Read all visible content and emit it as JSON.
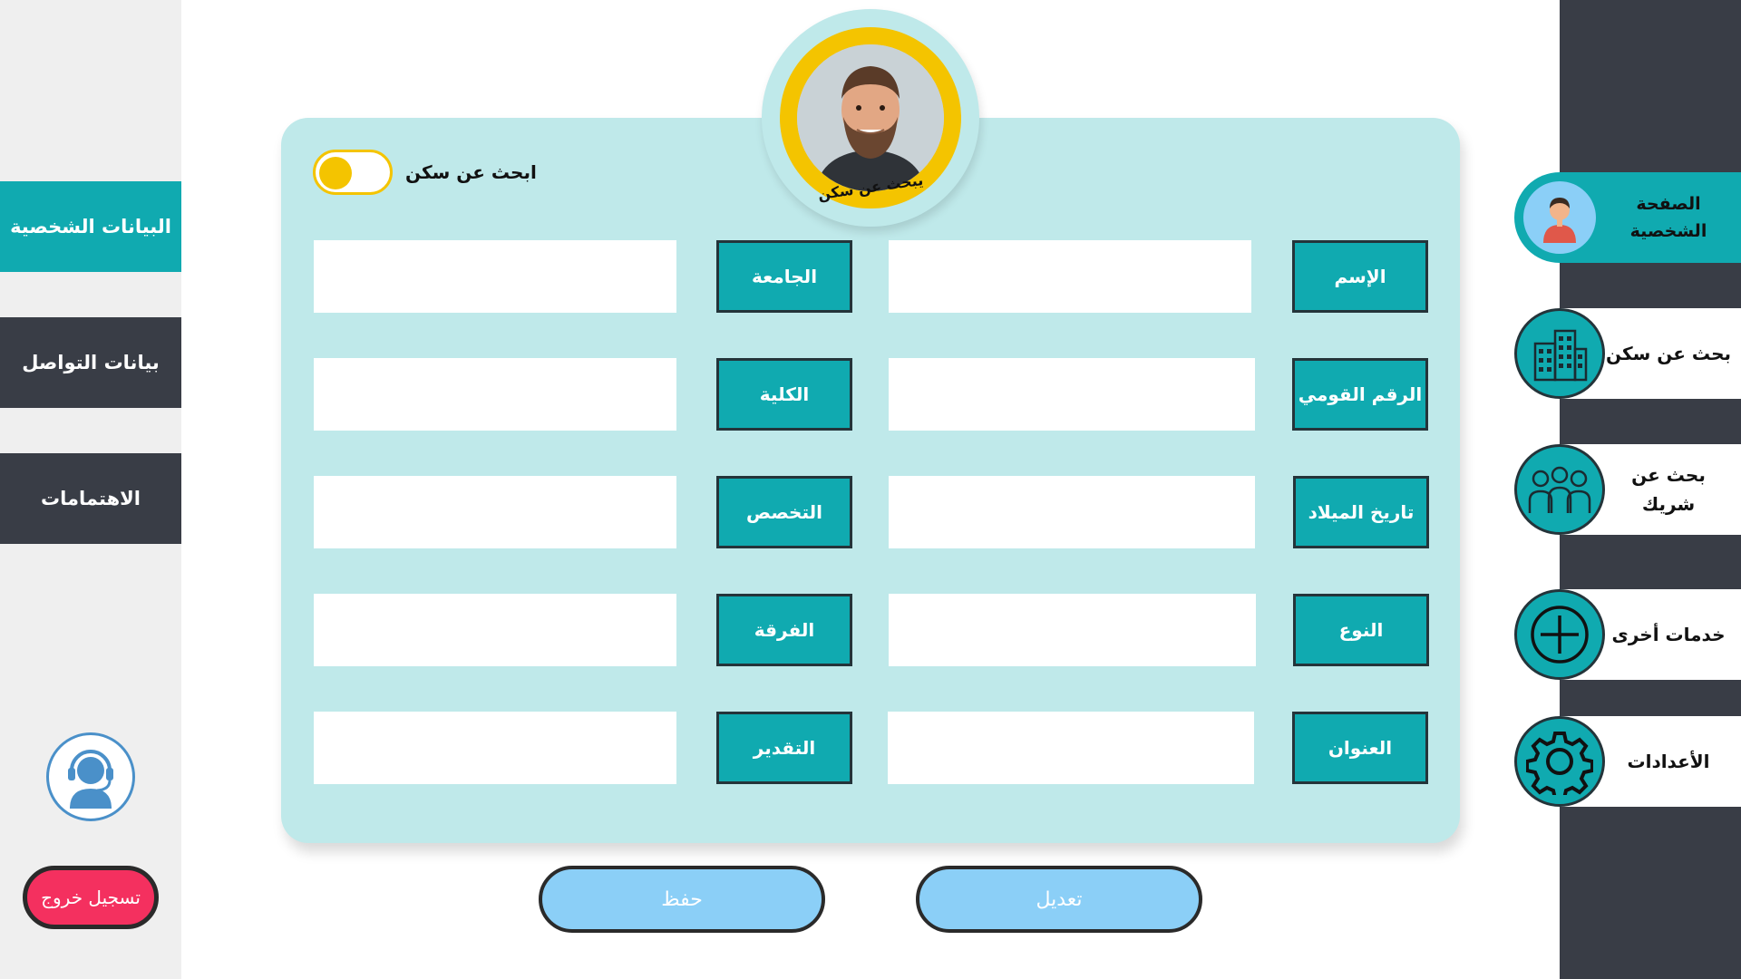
{
  "left_menu": [
    {
      "label": "البيانات الشخصية",
      "active": true
    },
    {
      "label": "بيانات التواصل",
      "active": false
    },
    {
      "label": "الاهتمامات",
      "active": false
    }
  ],
  "support": {
    "icon": "headset-support-icon"
  },
  "logout_label": "تسجيل خروج",
  "right_menu": [
    {
      "label": "الصفحة الشخصية",
      "icon": "user-avatar-icon",
      "active": true
    },
    {
      "label": "بحث عن سكن",
      "icon": "buildings-icon",
      "active": false
    },
    {
      "label": "بحث عن شريك",
      "icon": "people-group-icon",
      "active": false
    },
    {
      "label": "خدمات أخرى",
      "icon": "plus-circle-icon",
      "active": false
    },
    {
      "label": "الأعدادات",
      "icon": "gear-icon",
      "active": false
    }
  ],
  "profile": {
    "caption": "يبحث عن سكن",
    "toggle_label": "ابحث عن سكن",
    "toggle_on": true
  },
  "fields_right": [
    {
      "label": "الإسم",
      "value": ""
    },
    {
      "label": "الرقم القومي",
      "value": ""
    },
    {
      "label": "تاريخ الميلاد",
      "value": ""
    },
    {
      "label": "النوع",
      "value": ""
    },
    {
      "label": "العنوان",
      "value": ""
    }
  ],
  "fields_left": [
    {
      "label": "الجامعة",
      "value": ""
    },
    {
      "label": "الكلية",
      "value": ""
    },
    {
      "label": "التخصص",
      "value": ""
    },
    {
      "label": "الفرقة",
      "value": ""
    },
    {
      "label": "التقدير",
      "value": ""
    }
  ],
  "buttons": {
    "save": "حفظ",
    "edit": "تعديل"
  },
  "colors": {
    "accent": "#10aab0",
    "dark": "#393d46",
    "panel": "#bfe9ea",
    "yellow": "#f4c400",
    "logout": "#f4305f",
    "button": "#8bcff7"
  }
}
